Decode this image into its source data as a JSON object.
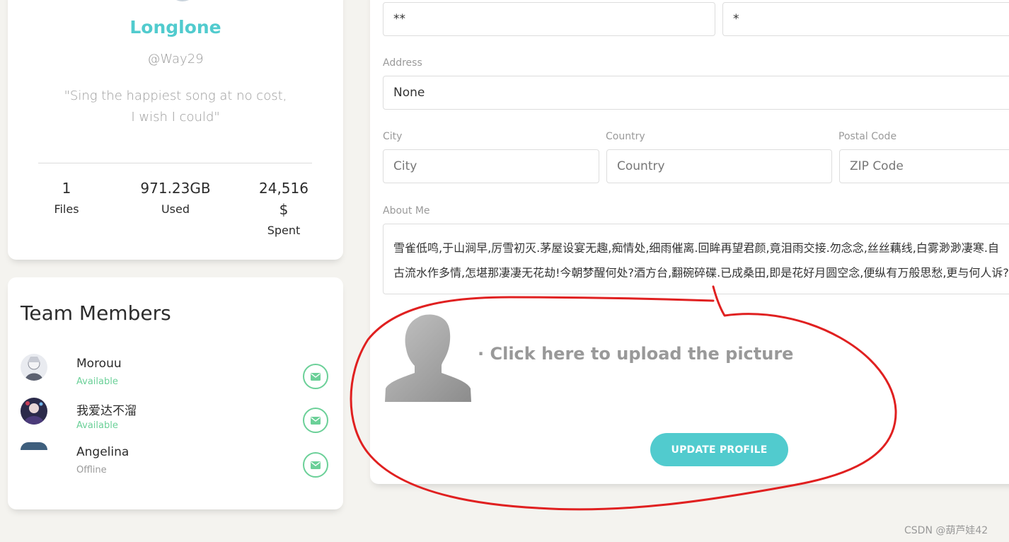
{
  "profile": {
    "name": "Longlone",
    "handle": "@Way29",
    "quote_line1": "\"Sing the happiest song at no cost,",
    "quote_line2": "I wish I could\"",
    "stats": [
      {
        "value": "1",
        "label": "Files"
      },
      {
        "value": "971.23GB",
        "label": "Used"
      },
      {
        "value": "24,516",
        "value2": "$",
        "label": "Spent"
      }
    ]
  },
  "team": {
    "title": "Team Members",
    "members": [
      {
        "name": "Morouu",
        "status": "Available"
      },
      {
        "name": "我爱达不溜",
        "status": "Available"
      },
      {
        "name": "Angelina",
        "status": "Offline"
      }
    ]
  },
  "form": {
    "top_left_value": "**",
    "top_right_value": "*",
    "address_label": "Address",
    "address_value": "None",
    "city_label": "City",
    "city_placeholder": "City",
    "country_label": "Country",
    "country_placeholder": "Country",
    "postal_label": "Postal Code",
    "postal_placeholder": "ZIP Code",
    "about_label": "About Me",
    "about_value": "雪雀低鸣,于山涧早,厉雪初灭.茅屋设宴无趣,痴情处,细雨催离.回眸再望君颜,竟泪雨交接.勿念念,丝丝藕线,白雾渺渺凄寒.自古流水作多情,怎堪那凄凄无花劫!今朝梦醒何处?酒方台,翻碗碎碟.已成桑田,即是花好月圆空念,便纵有万般思愁,更与何人诉?",
    "upload_text": "· Click here to upload the picture",
    "update_button": "UPDATE PROFILE"
  },
  "colors": {
    "accent": "#51cbce",
    "success": "#6bd098",
    "annotation": "#e02020"
  },
  "watermark": "CSDN @葫芦娃42"
}
